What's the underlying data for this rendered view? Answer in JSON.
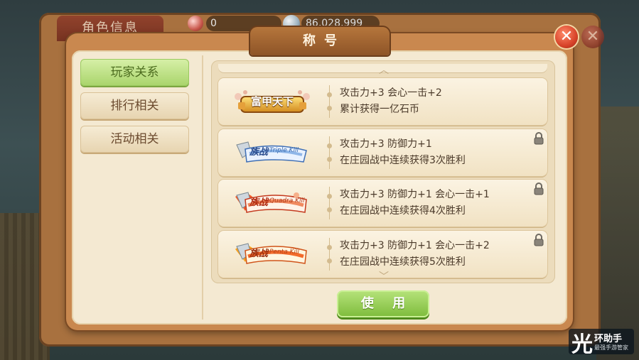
{
  "back": {
    "title": "角色信息",
    "gem_value": "0",
    "coin_value": "86,028,999"
  },
  "dialog": {
    "title": "称号",
    "close_label": "✕",
    "use_button": "使 用"
  },
  "categories": [
    {
      "label": "玩家关系",
      "active": true
    },
    {
      "label": "排行相关",
      "active": false
    },
    {
      "label": "活动相关",
      "active": false
    }
  ],
  "titles": [
    {
      "badge": "富甲天下",
      "badge_sub": "",
      "attr": "攻击力+3 会心一击+2",
      "cond": "累计获得一亿石币",
      "locked": false
    },
    {
      "badge": "族战",
      "badge_sub": "Triple Kill",
      "attr": "攻击力+3 防御力+1",
      "cond": "在庄园战中连续获得3次胜利",
      "locked": true
    },
    {
      "badge": "族战",
      "badge_sub": "Quadra Kill",
      "attr": "攻击力+3 防御力+1 会心一击+1",
      "cond": "在庄园战中连续获得4次胜利",
      "locked": true
    },
    {
      "badge": "族战",
      "badge_sub": "Penta Kill",
      "attr": "攻击力+3 防御力+1 会心一击+2",
      "cond": "在庄园战中连续获得5次胜利",
      "locked": true
    }
  ],
  "watermark": {
    "glyph": "光",
    "line1": "环助手",
    "line2": "最强手游管家"
  },
  "colors": {
    "active_tab": "#a9d46b",
    "close_button": "#d8442a",
    "use_button": "#7dbb3b"
  },
  "icons": {
    "gem": "red-gem-icon",
    "coin": "silver-coin-icon",
    "lock": "lock-icon",
    "scroll_up": "chevron-up-icon",
    "scroll_down": "chevron-down-icon"
  }
}
